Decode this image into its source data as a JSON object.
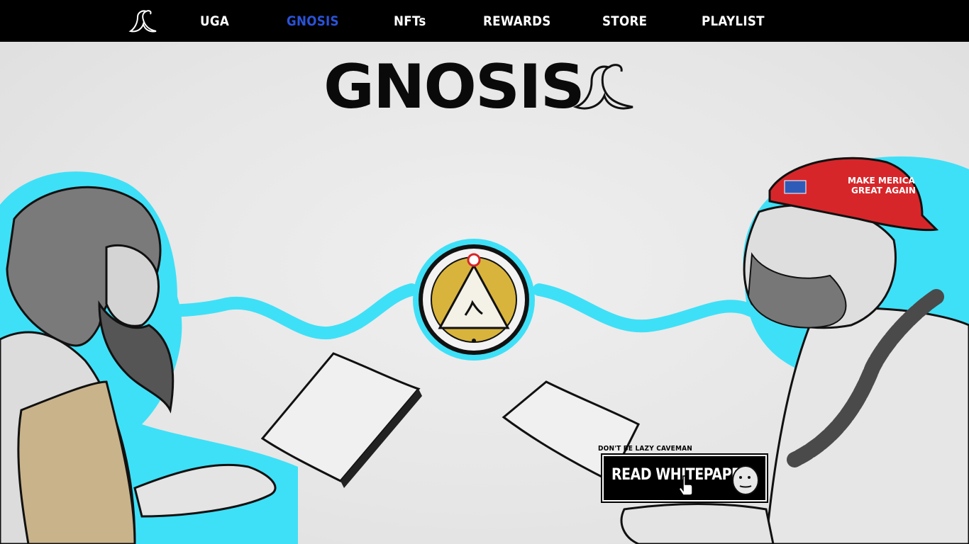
{
  "nav": {
    "logo_icon": "banana-peel-icon",
    "items": [
      {
        "label": "UGA",
        "active": false
      },
      {
        "label": "GNOSIS",
        "active": true
      },
      {
        "label": "NFTs",
        "active": false
      },
      {
        "label": "REWARDS",
        "active": false
      },
      {
        "label": "STORE",
        "active": false
      },
      {
        "label": "PLAYLIST",
        "active": false
      }
    ],
    "active_color": "#2a53d8"
  },
  "hero": {
    "wordmark": "GNOSIS",
    "wordmark_icon": "banana-peel-icon",
    "coin_icon": "pyramid-coin-icon",
    "cta": {
      "caption": "DON'T BE LAZY CAVEMAN",
      "label": "READ WHITEPAPER",
      "icon": "wojak-face-icon",
      "cursor_icon": "hand-cursor-icon"
    },
    "hat_text": [
      "MAKE MERICA",
      "GREAT AGAIN"
    ],
    "colors": {
      "glow": "#3ee0f7",
      "hat": "#d7262a",
      "coin_gold": "#d9b43c"
    }
  }
}
